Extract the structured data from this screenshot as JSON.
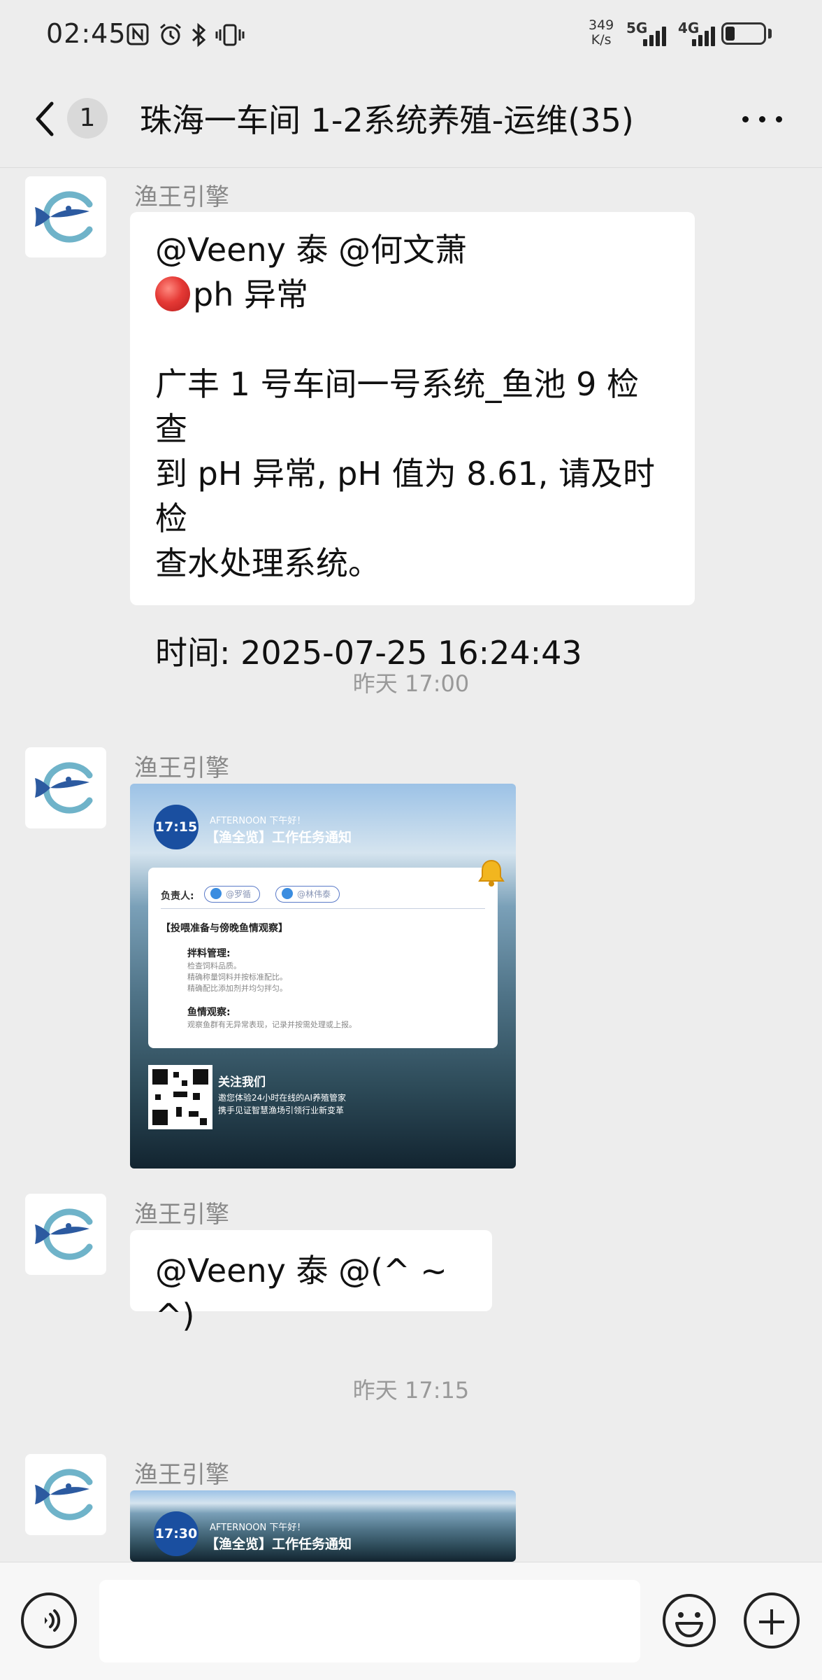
{
  "status_bar": {
    "time": "02:45",
    "net_speed_value": "349",
    "net_speed_unit": "K/s",
    "sim1_type": "5G",
    "sim2_type": "4G",
    "battery_percent": 20,
    "icons": [
      "nfc-icon",
      "alarm-icon",
      "bluetooth-icon",
      "vibrate-icon",
      "signal-icon",
      "battery-icon"
    ]
  },
  "header": {
    "unread_count": "1",
    "title": "珠海一车间 1-2系统养殖-运维(35)"
  },
  "messages": [
    {
      "sender": "渔王引擎",
      "type": "text",
      "lines": [
        "@Veeny 泰  @何文萧",
        "ph 异常",
        "",
        "广丰 1 号车间一号系统_鱼池 9 检查",
        "到 pH 异常, pH 值为 8.61, 请及时检",
        "查水处理系统。",
        "",
        "时间: 2025-07-25 16:24:43"
      ]
    },
    {
      "type": "timestamp",
      "text": "昨天 17:00"
    },
    {
      "sender": "渔王引擎",
      "type": "image",
      "card": {
        "clock": "17:15",
        "greeting": "AFTERNOON 下午好！",
        "notice_title": "【渔全览】工作任务通知",
        "owner_label": "负责人:",
        "owners": [
          "@罗循",
          "@林伟泰"
        ],
        "section": "【投喂准备与傍晚鱼情观察】",
        "items": [
          {
            "heading": "拌料管理:",
            "lines": [
              "检查饲料品质。",
              "精确称量饲料并按标准配比。",
              "精确配比添加剂并均匀拌匀。"
            ]
          },
          {
            "heading": "鱼情观察:",
            "lines": [
              "观察鱼群有无异常表现，记录并按需处理或上报。"
            ]
          }
        ],
        "follow_title": "关注我们",
        "follow_lines": [
          "邀您体验24小时在线的AI养殖管家",
          "携手见证智慧渔场引领行业新变革"
        ]
      }
    },
    {
      "sender": "渔王引擎",
      "type": "text",
      "lines": [
        "@Veeny 泰  @(^ ~ ^)"
      ]
    },
    {
      "type": "timestamp",
      "text": "昨天 17:15"
    },
    {
      "sender": "渔王引擎",
      "type": "image",
      "card": {
        "clock": "17:30",
        "greeting": "AFTERNOON 下午好！",
        "notice_title": "【渔全览】工作任务通知"
      }
    }
  ],
  "input_bar": {
    "value": "",
    "placeholder": ""
  },
  "colors": {
    "chat_background": "#ededed",
    "bubble": "#ffffff",
    "alert_dot": "#e53935",
    "avatar_blue": "#2c5aa0",
    "avatar_teal": "#6fb3c9"
  }
}
